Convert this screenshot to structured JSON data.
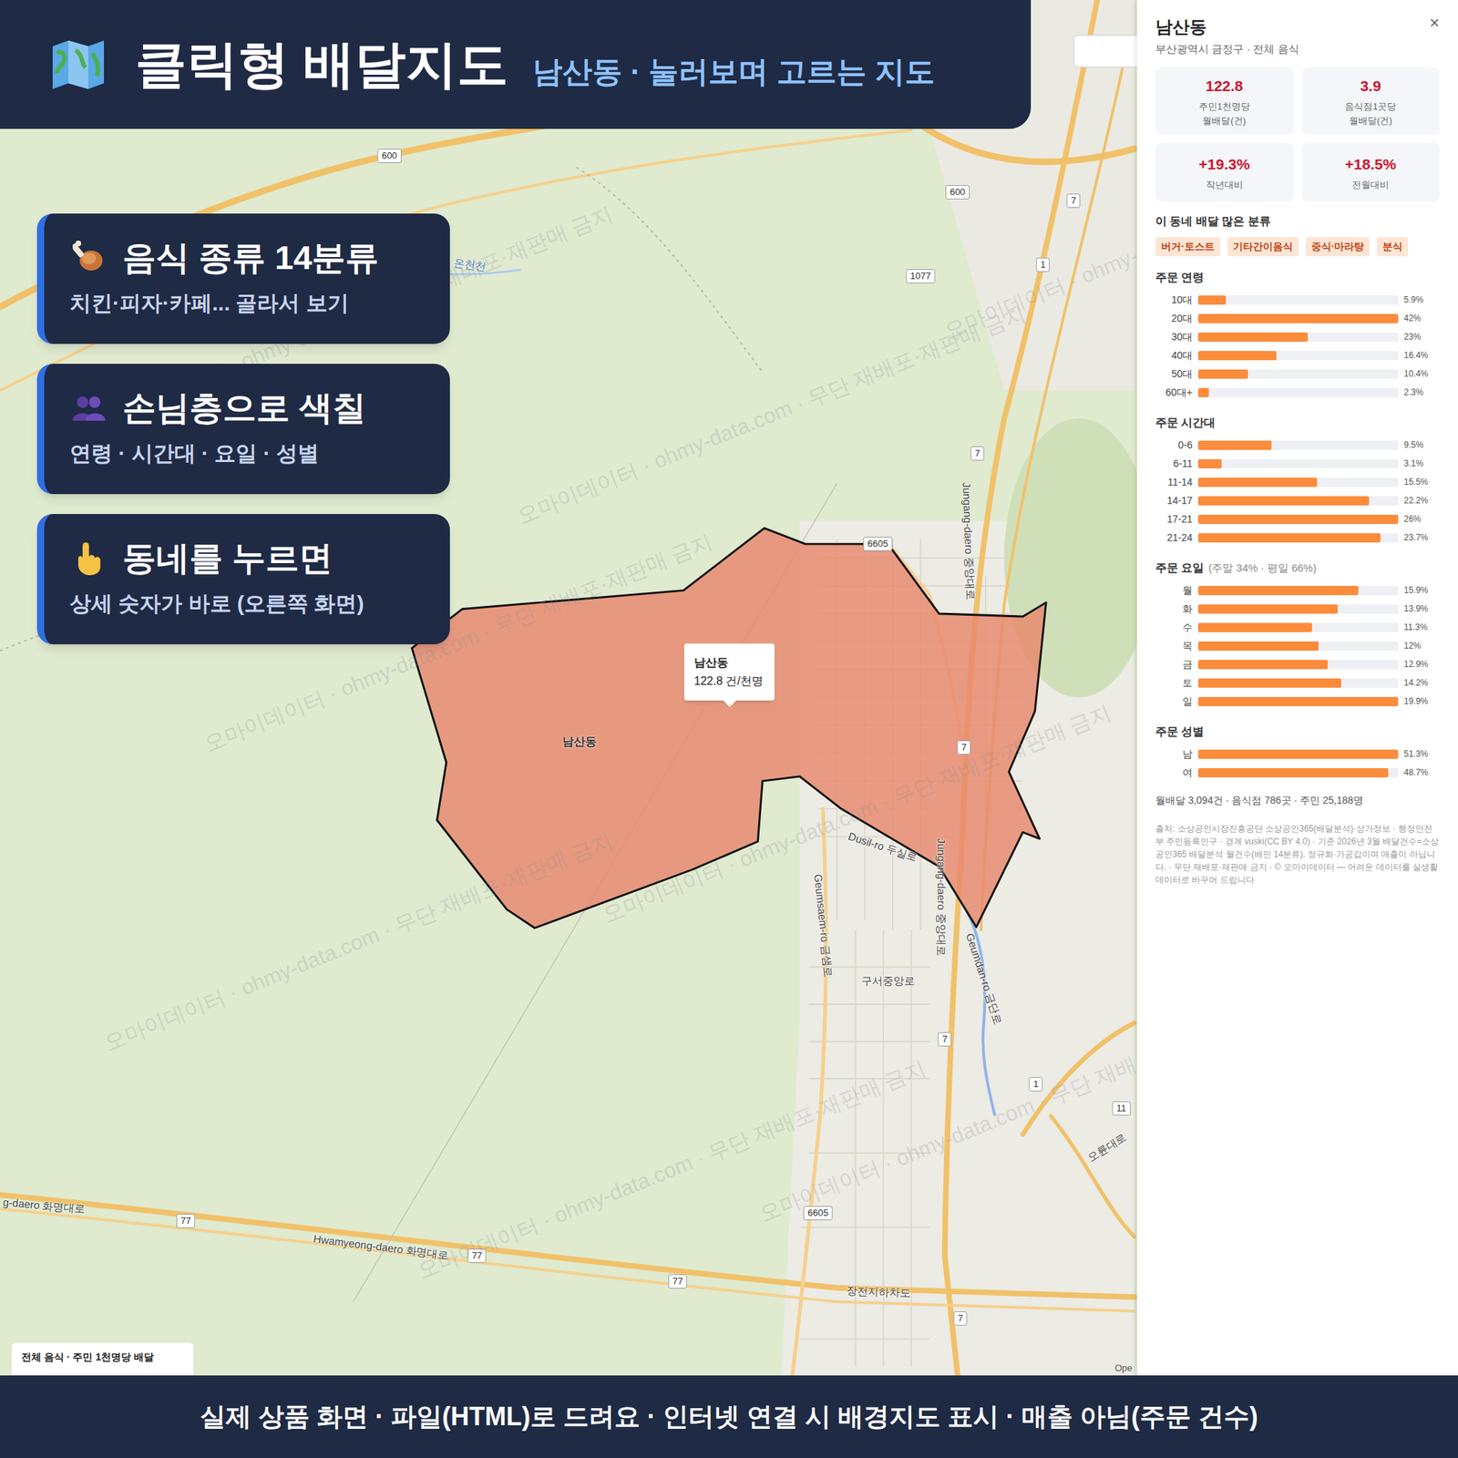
{
  "header": {
    "title": "클릭형 배달지도",
    "subtitle": "남산동 · 눌러보며 고르는 지도"
  },
  "cards": [
    {
      "title": "음식 종류 14분류",
      "subtitle": "치킨·피자·카페... 골라서 보기",
      "kind": "food"
    },
    {
      "title": "손님층으로 색칠",
      "subtitle": "연령 · 시간대 · 요일 · 성별",
      "kind": "people"
    },
    {
      "title": "동네를 누르면",
      "subtitle": "상세 숫자가 바로 (오른쪽 화면)",
      "kind": "pointer"
    }
  ],
  "map": {
    "region_label": "남산동",
    "tooltip": {
      "name": "남산동",
      "value": "122.8 건/천명"
    },
    "legend_title": "전체 음식 · 주민 1천명당 배달",
    "attribution": "Ope",
    "watermark": "오마이데이터 · ohmy-data.com · 무단 재배포·재판매 금지",
    "labels": [
      {
        "text": "600",
        "kind": "shield"
      },
      {
        "text": "600",
        "kind": "shield"
      },
      {
        "text": "1077",
        "kind": "shield"
      },
      {
        "text": "7",
        "kind": "shield"
      },
      {
        "text": "1",
        "kind": "shield"
      },
      {
        "text": "7",
        "kind": "shield"
      },
      {
        "text": "6605",
        "kind": "shield"
      },
      {
        "text": "7",
        "kind": "shield"
      },
      {
        "text": "7",
        "kind": "shield"
      },
      {
        "text": "1",
        "kind": "shield"
      },
      {
        "text": "11",
        "kind": "shield"
      },
      {
        "text": "6605",
        "kind": "shield"
      },
      {
        "text": "77",
        "kind": "shield"
      },
      {
        "text": "77",
        "kind": "shield"
      },
      {
        "text": "77",
        "kind": "shield"
      },
      {
        "text": "7",
        "kind": "shield"
      },
      {
        "text": "Hwamyeong-daero 화명대로",
        "kind": "road"
      },
      {
        "text": "g-daero 화명대로",
        "kind": "road"
      },
      {
        "text": "장전지하차도",
        "kind": "road"
      },
      {
        "text": "구서중앙로",
        "kind": "road"
      },
      {
        "text": "Dusil-ro 두실로",
        "kind": "road"
      },
      {
        "text": "Geumsaem-ro 금샘로",
        "kind": "road"
      },
      {
        "text": "Jungang-daero 중앙대로",
        "kind": "road"
      },
      {
        "text": "Jungang-daero 중앙대로",
        "kind": "road"
      },
      {
        "text": "Geumdan-ro 금단로",
        "kind": "road"
      },
      {
        "text": "오륜대로",
        "kind": "road"
      },
      {
        "text": "온천천",
        "kind": "water"
      }
    ]
  },
  "panel": {
    "title": "남산동",
    "close": "×",
    "subtitle": "부산광역시 금정구 · 전체 음식",
    "stats": [
      {
        "value": "122.8",
        "label": "주민1천명당",
        "sublabel": "월배달(건)"
      },
      {
        "value": "3.9",
        "label": "음식점1곳당",
        "sublabel": "월배달(건)"
      },
      {
        "value": "+19.3%",
        "label": "작년대비",
        "sublabel": ""
      },
      {
        "value": "+18.5%",
        "label": "전월대비",
        "sublabel": ""
      }
    ],
    "tags_title": "이 동네 배달 많은 분류",
    "tags": [
      "버거·토스트",
      "기타간이음식",
      "중식·마라탕",
      "분식"
    ],
    "sections": [
      {
        "title": "주문 연령",
        "note": "",
        "rows": [
          {
            "label": "10대",
            "reading": "5.9%",
            "level": 0.14
          },
          {
            "label": "20대",
            "reading": "42%",
            "level": 1
          },
          {
            "label": "30대",
            "reading": "23%",
            "level": 0.548
          },
          {
            "label": "40대",
            "reading": "16.4%",
            "level": 0.39
          },
          {
            "label": "50대",
            "reading": "10.4%",
            "level": 0.248
          },
          {
            "label": "60대+",
            "reading": "2.3%",
            "level": 0.055
          }
        ]
      },
      {
        "title": "주문 시간대",
        "note": "",
        "rows": [
          {
            "label": "0-6",
            "reading": "9.5%",
            "level": 0.365
          },
          {
            "label": "6-11",
            "reading": "3.1%",
            "level": 0.119
          },
          {
            "label": "11-14",
            "reading": "15.5%",
            "level": 0.596
          },
          {
            "label": "14-17",
            "reading": "22.2%",
            "level": 0.854
          },
          {
            "label": "17-21",
            "reading": "26%",
            "level": 1
          },
          {
            "label": "21-24",
            "reading": "23.7%",
            "level": 0.912
          }
        ]
      },
      {
        "title": "주문 요일",
        "note": "(주말 34% · 평일 66%)",
        "rows": [
          {
            "label": "월",
            "reading": "15.9%",
            "level": 0.799
          },
          {
            "label": "화",
            "reading": "13.9%",
            "level": 0.698
          },
          {
            "label": "수",
            "reading": "11.3%",
            "level": 0.568
          },
          {
            "label": "목",
            "reading": "12%",
            "level": 0.603
          },
          {
            "label": "금",
            "reading": "12.9%",
            "level": 0.648
          },
          {
            "label": "토",
            "reading": "14.2%",
            "level": 0.714
          },
          {
            "label": "일",
            "reading": "19.9%",
            "level": 1
          }
        ]
      },
      {
        "title": "주문 성별",
        "note": "",
        "rows": [
          {
            "label": "남",
            "reading": "51.3%",
            "level": 1
          },
          {
            "label": "여",
            "reading": "48.7%",
            "level": 0.949
          }
        ]
      }
    ],
    "summary": "월배달 3,094건 · 음식점 786곳 · 주민 25,188명",
    "source": "출처: 소상공인시장진흥공단 소상공인365(배달분석)·상가정보 · 행정안전부 주민등록인구 · 경계 vuski(CC BY 4.0) · 기준 2026년 3월 배달건수=소상공인365 배달분석 월건수(배민 14분류). 정규화·가공값이며 매출이 아닙니다. · 무단 재배포·재판매 금지 · © 오마이데이터 — 어려운 데이터를 실생활 데이터로 바꾸어 드립니다"
  },
  "footer": "실제 상품 화면 · 파일(HTML)로 드려요 · 인터넷 연결 시 배경지도 표시 · 매출 아님(주문 건수)"
}
